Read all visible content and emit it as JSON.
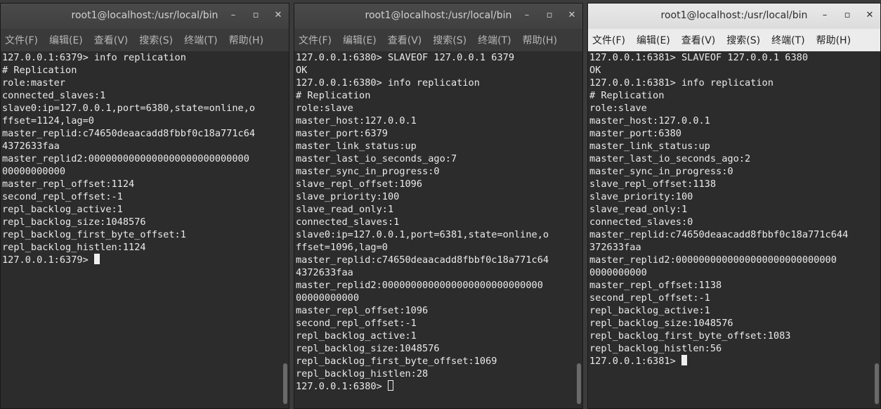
{
  "windows": [
    {
      "title": "root1@localhost:/usr/local/bin",
      "controls": {
        "minimize": "–",
        "maximize": "▫",
        "close": "✕"
      },
      "menu": [
        "文件(F)",
        "编辑(E)",
        "查看(V)",
        "搜索(S)",
        "终端(T)",
        "帮助(H)"
      ],
      "lines": [
        "127.0.0.1:6379> info replication",
        "# Replication",
        "role:master",
        "connected_slaves:1",
        "slave0:ip=127.0.0.1,port=6380,state=online,o",
        "ffset=1124,lag=0",
        "master_replid:c74650deaacadd8fbbf0c18a771c64",
        "4372633faa",
        "master_replid2:0000000000000000000000000000",
        "00000000000",
        "master_repl_offset:1124",
        "second_repl_offset:-1",
        "repl_backlog_active:1",
        "repl_backlog_size:1048576",
        "repl_backlog_first_byte_offset:1",
        "repl_backlog_histlen:1124"
      ],
      "prompt": "127.0.0.1:6379> "
    },
    {
      "title": "root1@localhost:/usr/local/bin",
      "controls": {
        "minimize": "–",
        "maximize": "▫",
        "close": "✕"
      },
      "menu": [
        "文件(F)",
        "编辑(E)",
        "查看(V)",
        "搜索(S)",
        "终端(T)",
        "帮助(H)"
      ],
      "lines": [
        "127.0.0.1:6380> SLAVEOF 127.0.0.1 6379",
        "OK",
        "127.0.0.1:6380> info replication",
        "# Replication",
        "role:slave",
        "master_host:127.0.0.1",
        "master_port:6379",
        "master_link_status:up",
        "master_last_io_seconds_ago:7",
        "master_sync_in_progress:0",
        "slave_repl_offset:1096",
        "slave_priority:100",
        "slave_read_only:1",
        "connected_slaves:1",
        "slave0:ip=127.0.0.1,port=6381,state=online,o",
        "ffset=1096,lag=0",
        "master_replid:c74650deaacadd8fbbf0c18a771c64",
        "4372633faa",
        "master_replid2:0000000000000000000000000000",
        "00000000000",
        "master_repl_offset:1096",
        "second_repl_offset:-1",
        "repl_backlog_active:1",
        "repl_backlog_size:1048576",
        "repl_backlog_first_byte_offset:1069",
        "repl_backlog_histlen:28"
      ],
      "prompt": "127.0.0.1:6380> "
    },
    {
      "title": "root1@localhost:/usr/local/bin",
      "controls": {
        "minimize": "–",
        "maximize": "▫",
        "close": "✕"
      },
      "menu": [
        "文件(F)",
        "编辑(E)",
        "查看(V)",
        "搜索(S)",
        "终端(T)",
        "帮助(H)"
      ],
      "lines": [
        "127.0.0.1:6381> SLAVEOF 127.0.0.1 6380",
        "OK",
        "127.0.0.1:6381> info replication",
        "# Replication",
        "role:slave",
        "master_host:127.0.0.1",
        "master_port:6380",
        "master_link_status:up",
        "master_last_io_seconds_ago:2",
        "master_sync_in_progress:0",
        "slave_repl_offset:1138",
        "slave_priority:100",
        "slave_read_only:1",
        "connected_slaves:0",
        "master_replid:c74650deaacadd8fbbf0c18a771c644",
        "372633faa",
        "master_replid2:0000000000000000000000000000",
        "0000000000",
        "master_repl_offset:1138",
        "second_repl_offset:-1",
        "repl_backlog_active:1",
        "repl_backlog_size:1048576",
        "repl_backlog_first_byte_offset:1083",
        "repl_backlog_histlen:56"
      ],
      "prompt": "127.0.0.1:6381> "
    }
  ]
}
